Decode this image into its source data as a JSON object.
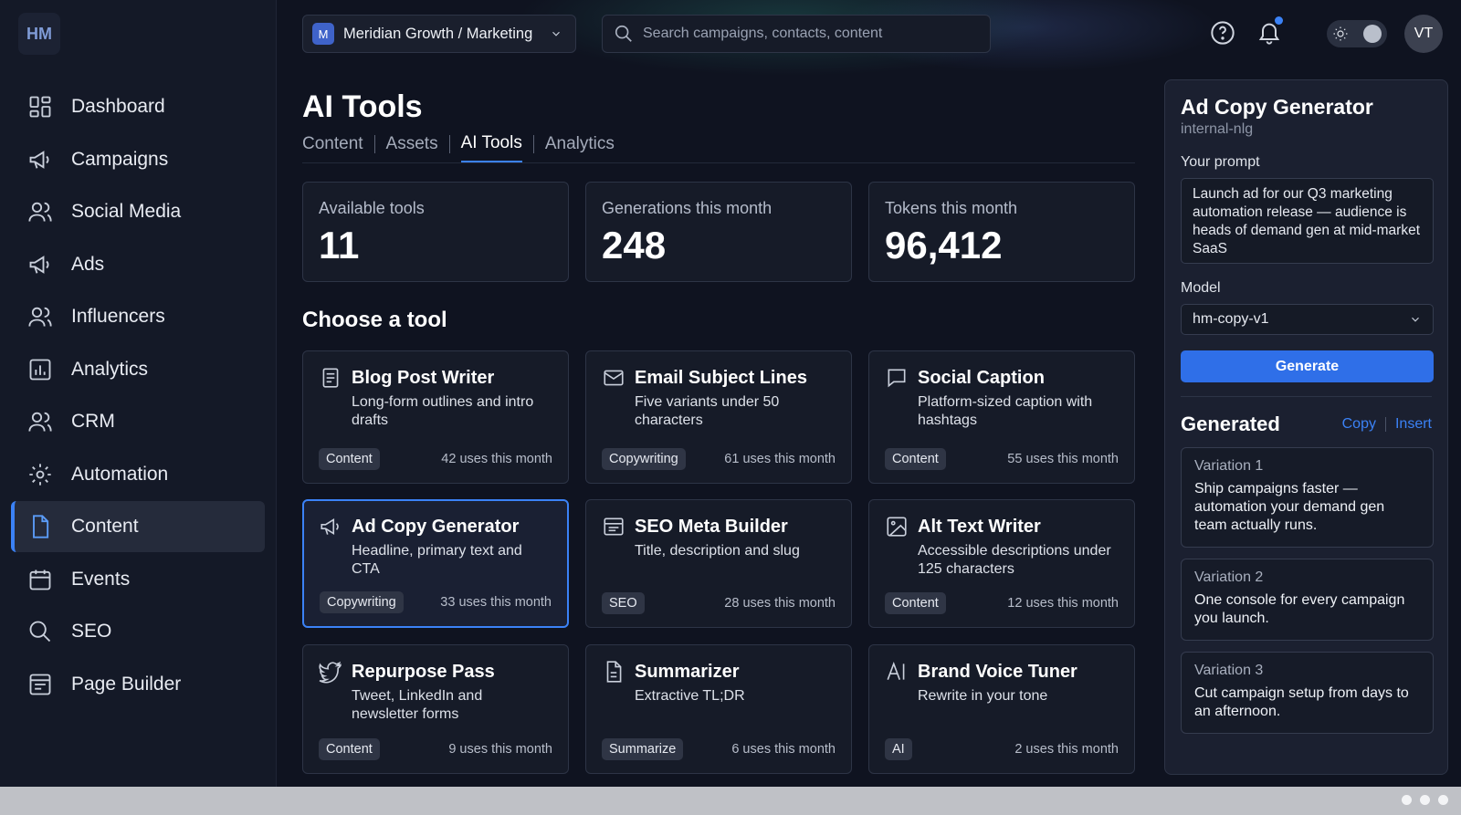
{
  "app": {
    "logo": "HM"
  },
  "sidebar": {
    "items": [
      {
        "label": "Dashboard",
        "icon": "grid-icon"
      },
      {
        "label": "Campaigns",
        "icon": "megaphone-icon"
      },
      {
        "label": "Social Media",
        "icon": "users-icon"
      },
      {
        "label": "Ads",
        "icon": "megaphone-icon"
      },
      {
        "label": "Influencers",
        "icon": "users-icon"
      },
      {
        "label": "Analytics",
        "icon": "bar-chart-icon"
      },
      {
        "label": "CRM",
        "icon": "users-icon"
      },
      {
        "label": "Automation",
        "icon": "gear-icon"
      },
      {
        "label": "Content",
        "icon": "file-icon",
        "active": true
      },
      {
        "label": "Events",
        "icon": "calendar-icon"
      },
      {
        "label": "SEO",
        "icon": "search-icon"
      },
      {
        "label": "Page Builder",
        "icon": "layout-icon"
      }
    ]
  },
  "header": {
    "workspace_badge": "M",
    "workspace": "Meridian Growth / Marketing",
    "search_placeholder": "Search campaigns, contacts, content",
    "avatar": "VT"
  },
  "page": {
    "title": "AI Tools",
    "tabs": [
      "Content",
      "Assets",
      "AI Tools",
      "Analytics"
    ],
    "active_tab": "AI Tools"
  },
  "stats": [
    {
      "label": "Available tools",
      "value": "11"
    },
    {
      "label": "Generations this month",
      "value": "248"
    },
    {
      "label": "Tokens this month",
      "value": "96,412"
    }
  ],
  "tools_section_title": "Choose a tool",
  "tools": [
    {
      "title": "Blog Post Writer",
      "desc": "Long-form outlines and intro drafts",
      "tag": "Content",
      "uses": "42 uses this month",
      "icon": "document-icon"
    },
    {
      "title": "Email Subject Lines",
      "desc": "Five variants under 50 characters",
      "tag": "Copywriting",
      "uses": "61 uses this month",
      "icon": "mail-icon"
    },
    {
      "title": "Social Caption",
      "desc": "Platform-sized caption with hashtags",
      "tag": "Content",
      "uses": "55 uses this month",
      "icon": "chat-bubble-icon"
    },
    {
      "title": "Ad Copy Generator",
      "desc": "Headline, primary text and CTA",
      "tag": "Copywriting",
      "uses": "33 uses this month",
      "icon": "megaphone-icon",
      "selected": true
    },
    {
      "title": "SEO Meta Builder",
      "desc": "Title, description and slug",
      "tag": "SEO",
      "uses": "28 uses this month",
      "icon": "browser-window-icon"
    },
    {
      "title": "Alt Text Writer",
      "desc": "Accessible descriptions under 125 characters",
      "tag": "Content",
      "uses": "12 uses this month",
      "icon": "image-icon"
    },
    {
      "title": "Repurpose Pass",
      "desc": "Tweet, LinkedIn and newsletter forms",
      "tag": "Content",
      "uses": "9 uses this month",
      "icon": "bird-icon"
    },
    {
      "title": "Summarizer",
      "desc": "Extractive TL;DR",
      "tag": "Summarize",
      "uses": "6 uses this month",
      "icon": "file-text-icon"
    },
    {
      "title": "Brand Voice Tuner",
      "desc": "Rewrite in your tone",
      "tag": "AI",
      "uses": "2 uses this month",
      "icon": "ai-icon"
    }
  ],
  "panel": {
    "title": "Ad Copy Generator",
    "subtitle": "internal-nlg",
    "prompt_label": "Your prompt",
    "prompt": "Launch ad for our Q3 marketing automation release — audience is heads of demand gen at mid-market SaaS",
    "model_label": "Model",
    "model": "hm-copy-v1",
    "generate_label": "Generate",
    "generated_title": "Generated",
    "copy_label": "Copy",
    "insert_label": "Insert",
    "variations": [
      {
        "name": "Variation 1",
        "text": "Ship campaigns faster — automation your demand gen team actually runs."
      },
      {
        "name": "Variation 2",
        "text": "One console for every campaign you launch."
      },
      {
        "name": "Variation 3",
        "text": "Cut campaign setup from days to an afternoon."
      }
    ]
  },
  "colors": {
    "accent": "#3b82f6",
    "background": "#0f1320",
    "card": "#161b28"
  }
}
